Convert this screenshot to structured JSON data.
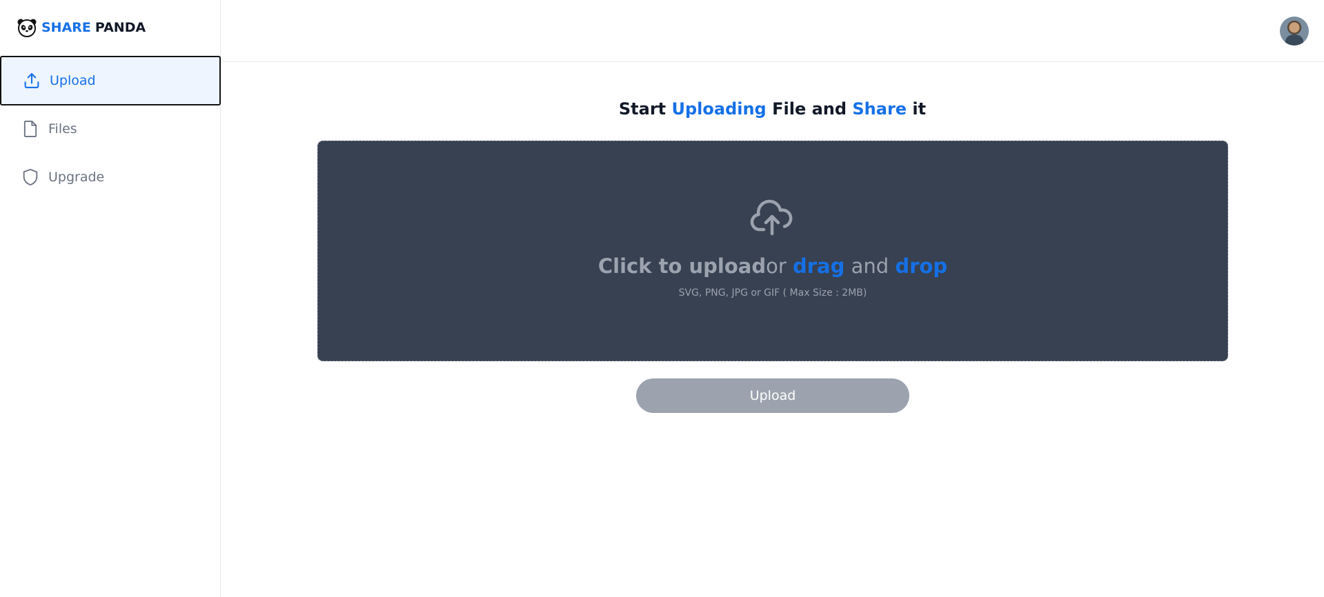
{
  "brand": {
    "name_part1": "SHARE",
    "name_part2": "PANDA",
    "accent_color": "#1570e6"
  },
  "sidebar": {
    "items": [
      {
        "label": "Upload",
        "icon": "upload-icon",
        "active": true
      },
      {
        "label": "Files",
        "icon": "file-icon",
        "active": false
      },
      {
        "label": "Upgrade",
        "icon": "shield-icon",
        "active": false
      }
    ]
  },
  "header": {
    "avatar": "user-avatar"
  },
  "main": {
    "heading": {
      "part1": "Start ",
      "highlight1": "Uploading",
      "part2": " File and ",
      "highlight2": "Share",
      "part3": " it"
    },
    "dropzone": {
      "icon": "cloud-upload-icon",
      "title_bold": "Click to upload",
      "title_or": "or ",
      "title_drag": "drag",
      "title_and": " and ",
      "title_drop": "drop",
      "subtitle": "SVG, PNG, JPG or GIF ( Max Size : 2MB)",
      "background_color": "#374151"
    },
    "upload_button": {
      "label": "Upload",
      "disabled_color": "#9ca3af"
    }
  }
}
